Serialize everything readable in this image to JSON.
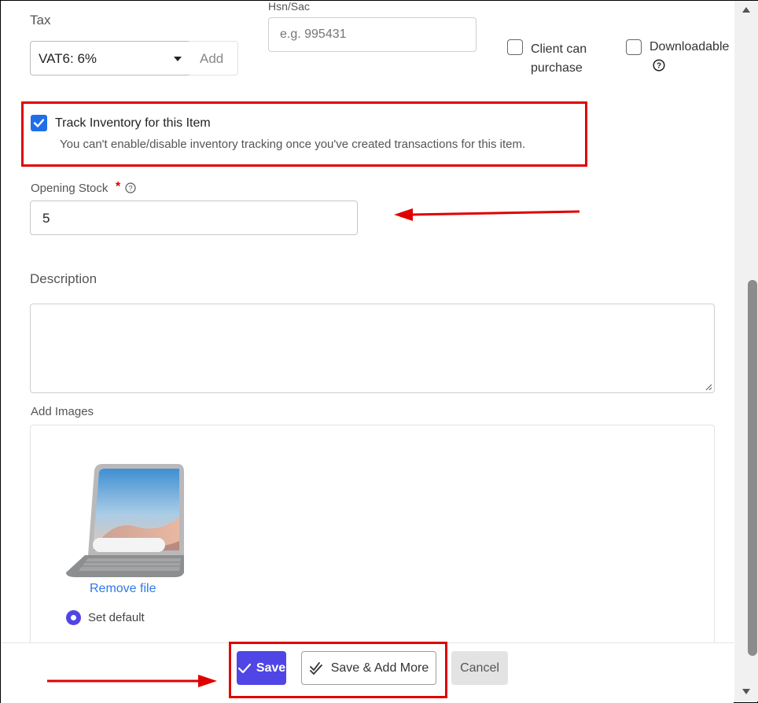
{
  "tax": {
    "label": "Tax",
    "selected": "VAT6: 6%",
    "add_label": "Add"
  },
  "hsn": {
    "label": "Hsn/Sac",
    "placeholder": "e.g. 995431"
  },
  "client_can_purchase": {
    "line1": "Client can",
    "line2": "purchase",
    "checked": false
  },
  "downloadable": {
    "label": "Downloadable",
    "checked": false
  },
  "track_inventory": {
    "label": "Track Inventory for this Item",
    "hint": "You can't enable/disable inventory tracking once you've created transactions for this item.",
    "checked": true
  },
  "opening_stock": {
    "label": "Opening Stock",
    "required_mark": "*",
    "value": "5"
  },
  "description": {
    "label": "Description",
    "value": ""
  },
  "images": {
    "label": "Add Images",
    "remove_label": "Remove file",
    "default_label": "Set default"
  },
  "footer": {
    "save_label": "Save",
    "save_add_more_label": "Save & Add More",
    "cancel_label": "Cancel"
  },
  "colors": {
    "primary": "#4f46e5",
    "link": "#2f7ae5",
    "annotation": "#e00000"
  }
}
